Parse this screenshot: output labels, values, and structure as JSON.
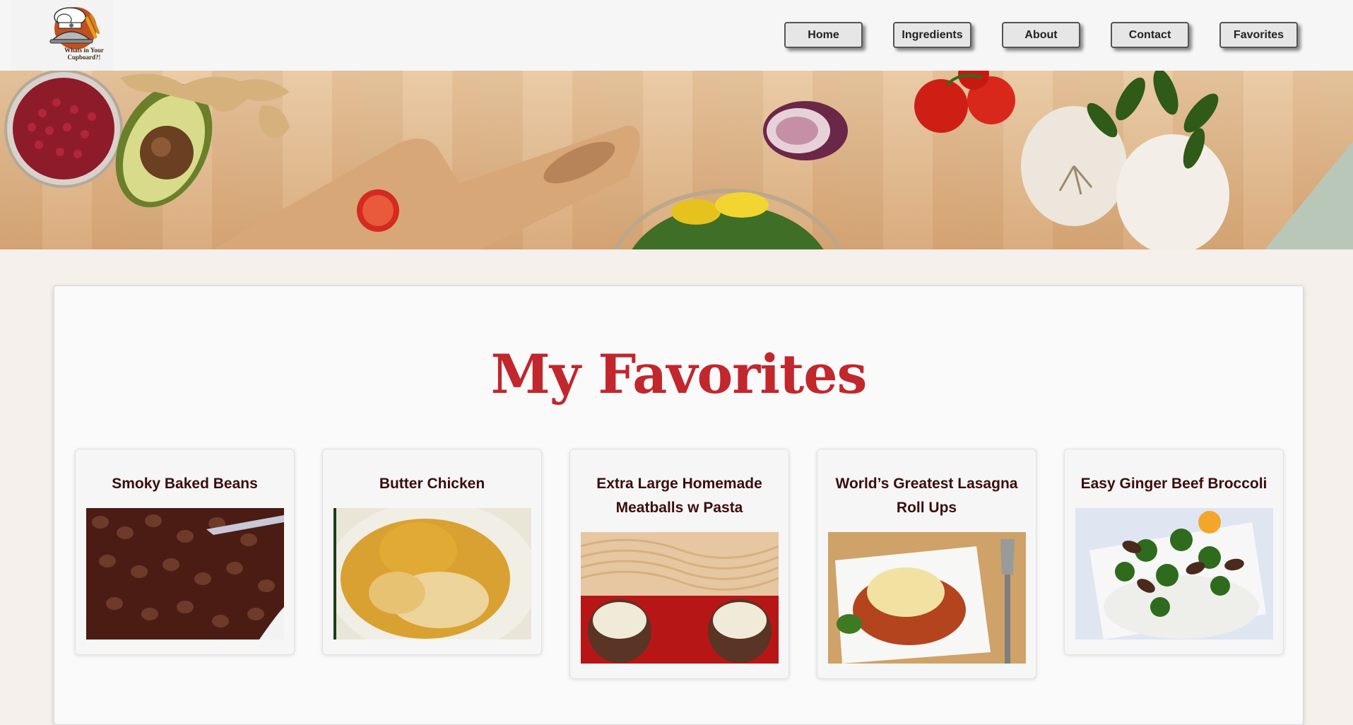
{
  "header": {
    "logo_text": "Whats in Your Cupboard?!",
    "nav": [
      {
        "label": "Home"
      },
      {
        "label": "Ingredients"
      },
      {
        "label": "About"
      },
      {
        "label": "Contact"
      },
      {
        "label": "Favorites"
      }
    ]
  },
  "main": {
    "title": "My Favorites",
    "cards": [
      {
        "title": "Smoky Baked Beans"
      },
      {
        "title": "Butter Chicken"
      },
      {
        "title": "Extra Large Homemade Meatballs w Pasta"
      },
      {
        "title": "World’s Greatest Lasagna Roll Ups"
      },
      {
        "title": "Easy Ginger Beef Broccoli"
      }
    ]
  },
  "colors": {
    "title_red": "#c1272d",
    "card_title": "#3b0d0d",
    "page_bg": "#f5f0eb"
  }
}
